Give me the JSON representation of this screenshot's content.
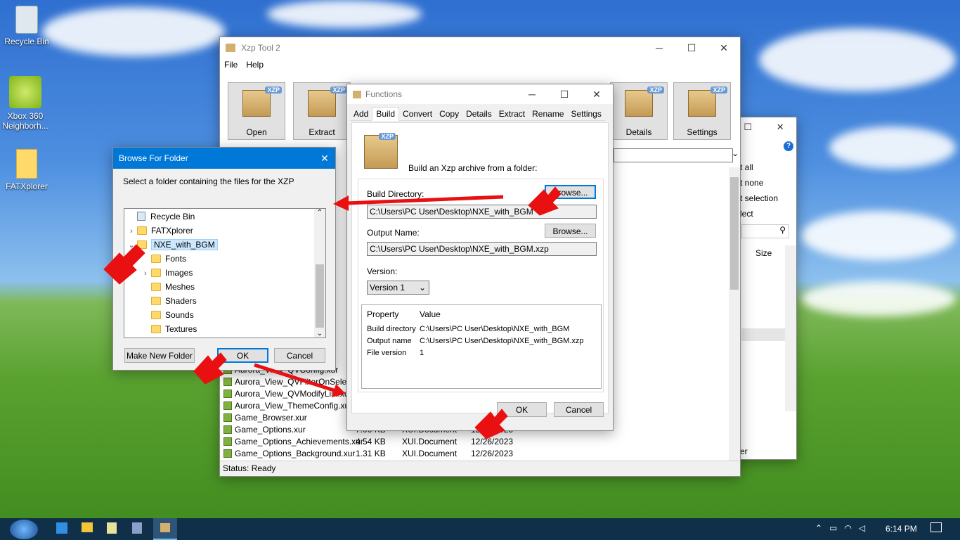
{
  "desktop": {
    "icons": [
      {
        "label": "Recycle Bin"
      },
      {
        "label": "Xbox 360 Neighborh..."
      },
      {
        "label": "FATXplorer"
      }
    ]
  },
  "main_window": {
    "title": "Xzp Tool 2",
    "menu": [
      "File",
      "Help"
    ],
    "toolbar": [
      {
        "label": "Open"
      },
      {
        "label": "Extract"
      },
      {
        "label": "Details"
      },
      {
        "label": "Settings"
      }
    ],
    "status": "Status: Ready",
    "files": [
      {
        "name": "Aurora_View_QVConfig.xur",
        "size": "",
        "type": "",
        "date": ""
      },
      {
        "name": "Aurora_View_QVFilterOnSelect.xur",
        "size": "",
        "type": "",
        "date": ""
      },
      {
        "name": "Aurora_View_QVModifyList.xur",
        "size": "",
        "type": "",
        "date": ""
      },
      {
        "name": "Aurora_View_ThemeConfig.xur",
        "size": "",
        "type": "",
        "date": ""
      },
      {
        "name": "Game_Browser.xur",
        "size": "",
        "type": "",
        "date": ""
      },
      {
        "name": "Game_Options.xur",
        "size": "7.06 KB",
        "type": "XUI.Document",
        "date": "12/26/2023"
      },
      {
        "name": "Game_Options_Achievements.xur",
        "size": "4.54 KB",
        "type": "XUI.Document",
        "date": "12/26/2023"
      },
      {
        "name": "Game_Options_Background.xur",
        "size": "1.31 KB",
        "type": "XUI.Document",
        "date": "12/26/2023"
      }
    ]
  },
  "explorer_bg": {
    "items": [
      "t all",
      "t none",
      "t selection",
      "lect"
    ],
    "size_header": "Size",
    "footer": "er"
  },
  "functions_dialog": {
    "title": "Functions",
    "tabs": [
      "Add",
      "Build",
      "Convert",
      "Copy",
      "Details",
      "Extract",
      "Rename",
      "Settings"
    ],
    "active_tab": "Build",
    "description": "Build an Xzp archive from a folder:",
    "build_dir_label": "Build Directory:",
    "build_dir_value": "C:\\Users\\PC User\\Desktop\\NXE_with_BGM",
    "output_label": "Output Name:",
    "output_value": "C:\\Users\\PC User\\Desktop\\NXE_with_BGM.xzp",
    "browse_label": "Browse...",
    "version_label": "Version:",
    "version_value": "Version 1",
    "prop_header": "Property",
    "value_header": "Value",
    "props": [
      {
        "k": "Build directory",
        "v": "C:\\Users\\PC User\\Desktop\\NXE_with_BGM"
      },
      {
        "k": "Output name",
        "v": "C:\\Users\\PC User\\Desktop\\NXE_with_BGM.xzp"
      },
      {
        "k": "File version",
        "v": "1"
      }
    ],
    "ok": "OK",
    "cancel": "Cancel"
  },
  "browse_dialog": {
    "title": "Browse For Folder",
    "prompt": "Select a folder containing the files for the XZP",
    "tree": [
      {
        "label": "Recycle Bin",
        "indent": 0,
        "expander": "",
        "selected": false
      },
      {
        "label": "FATXplorer",
        "indent": 0,
        "expander": ">",
        "selected": false
      },
      {
        "label": "NXE_with_BGM",
        "indent": 0,
        "expander": "v",
        "selected": true
      },
      {
        "label": "Fonts",
        "indent": 1,
        "expander": "",
        "selected": false
      },
      {
        "label": "Images",
        "indent": 1,
        "expander": ">",
        "selected": false
      },
      {
        "label": "Meshes",
        "indent": 1,
        "expander": "",
        "selected": false
      },
      {
        "label": "Shaders",
        "indent": 1,
        "expander": "",
        "selected": false
      },
      {
        "label": "Sounds",
        "indent": 1,
        "expander": "",
        "selected": false
      },
      {
        "label": "Textures",
        "indent": 1,
        "expander": "",
        "selected": false
      }
    ],
    "new_folder": "Make New Folder",
    "ok": "OK",
    "cancel": "Cancel"
  },
  "taskbar": {
    "time": "6:14 PM"
  }
}
